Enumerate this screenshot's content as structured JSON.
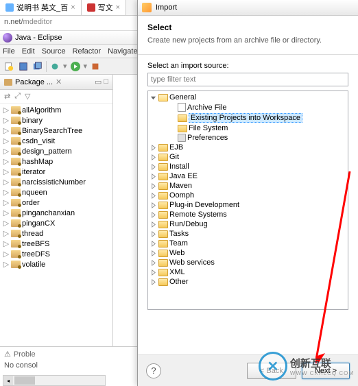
{
  "browser": {
    "tabs": [
      {
        "icon": "#3399ff",
        "label": "说明书 英文_百",
        "close": "×"
      },
      {
        "icon": "#cc3333",
        "label": "写文",
        "close": "×"
      }
    ],
    "url_host": "n.net/",
    "url_path": "mdeditor"
  },
  "eclipse": {
    "title": "Java - Eclipse",
    "menu": [
      "File",
      "Edit",
      "Source",
      "Refactor",
      "Navigate"
    ],
    "package_panel": {
      "title": "Package ...",
      "items": [
        "allAlgorithm",
        "binary",
        "BinarySearchTree",
        "csdn_visit",
        "design_pattern",
        "hashMap",
        "iterator",
        "narcissisticNumber",
        "nqueen",
        "order",
        "pinganchanxian",
        "pinganCX",
        "thread",
        "treeBFS",
        "treeDFS",
        "volatile"
      ]
    },
    "console": {
      "tab": "Proble",
      "text": "No consol"
    }
  },
  "dialog": {
    "window_title": "Import",
    "heading": "Select",
    "description": "Create new projects from an archive file or directory.",
    "body_label": "Select an import source:",
    "filter_placeholder": "type filter text",
    "tree": {
      "general": {
        "label": "General",
        "children": [
          "Archive File",
          "Existing Projects into Workspace",
          "File System",
          "Preferences"
        ]
      },
      "collapsed": [
        "EJB",
        "Git",
        "Install",
        "Java EE",
        "Maven",
        "Oomph",
        "Plug-in Development",
        "Remote Systems",
        "Run/Debug",
        "Tasks",
        "Team",
        "Web",
        "Web services",
        "XML",
        "Other"
      ]
    },
    "buttons": {
      "back": "< Back",
      "next": "Next >"
    }
  },
  "watermark": {
    "symbol": "✕",
    "text": "创新互联",
    "sub": "WWW CXHLCQ COM"
  }
}
